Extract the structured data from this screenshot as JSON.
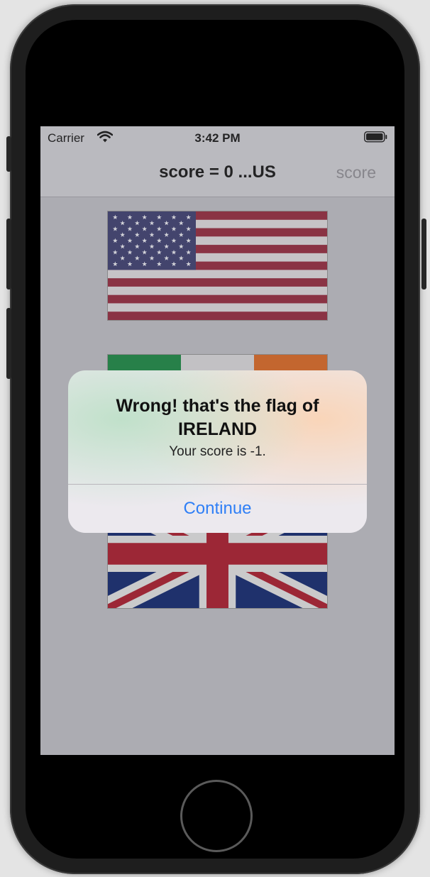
{
  "status_bar": {
    "carrier": "Carrier",
    "time": "3:42 PM"
  },
  "nav_bar": {
    "title": "score = 0 ...US",
    "right_button": "score"
  },
  "flags": [
    {
      "country": "United States",
      "icon": "us-flag"
    },
    {
      "country": "Ireland",
      "icon": "ireland-flag"
    },
    {
      "country": "United Kingdom",
      "icon": "uk-flag"
    }
  ],
  "alert": {
    "title": "Wrong! that's the flag of IRELAND",
    "message": "Your score is -1.",
    "button": "Continue"
  },
  "colors": {
    "us_red": "#8e2437",
    "us_blue": "#38396a",
    "ireland_green": "#15823e",
    "ireland_orange": "#d3621e",
    "uk_red": "#a41527",
    "uk_blue": "#0b2268",
    "alert_button": "#2f7ff6"
  }
}
